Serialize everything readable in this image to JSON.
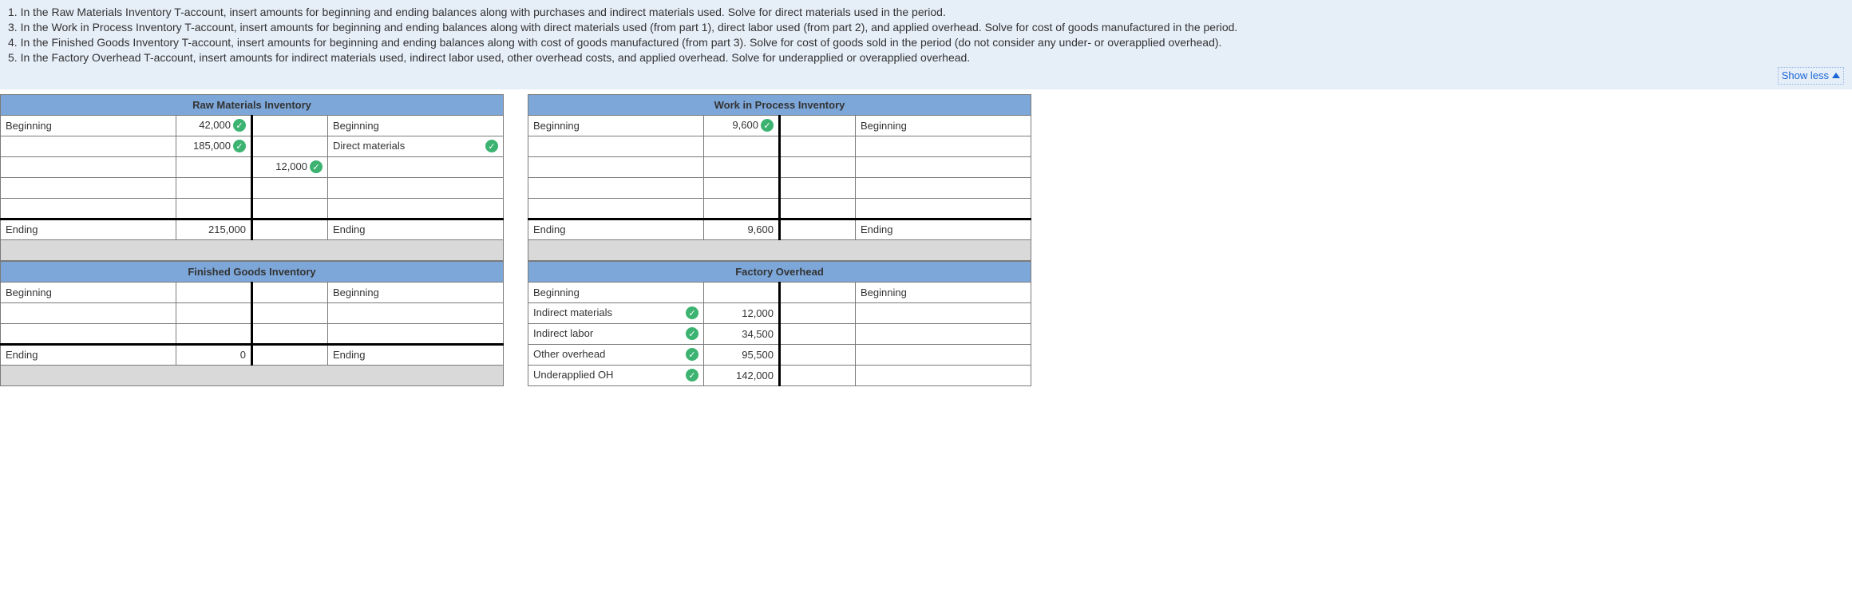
{
  "instructions": {
    "line1": "1. In the Raw Materials Inventory T-account, insert amounts for beginning and ending balances along with purchases and indirect materials used. Solve for direct materials used in the period.",
    "line3": "3. In the Work in Process Inventory T-account, insert amounts for beginning and ending balances along with direct materials used (from part 1), direct labor used (from part 2), and applied overhead. Solve for cost of goods manufactured in the period.",
    "line4": "4. In the Finished Goods Inventory T-account, insert amounts for beginning and ending balances along with cost of goods manufactured (from part 3). Solve for cost of goods sold in the period (do not consider any under- or overapplied overhead).",
    "line5": "5. In the Factory Overhead T-account, insert amounts for indirect materials used, indirect labor used, other overhead costs, and applied overhead. Solve for underapplied or overapplied overhead."
  },
  "show_less": "Show less",
  "labels": {
    "beginning": "Beginning",
    "ending": "Ending",
    "direct_materials": "Direct materials",
    "indirect_materials": "Indirect materials",
    "indirect_labor": "Indirect labor",
    "other_overhead": "Other overhead",
    "underapplied_oh": "Underapplied OH"
  },
  "accounts": {
    "raw": {
      "title": "Raw Materials Inventory",
      "rows": [
        {
          "l_label": "Beginning",
          "l_val": "42,000",
          "l_check": true,
          "r_val": "",
          "r_label": "Beginning"
        },
        {
          "l_label": "",
          "l_val": "185,000",
          "l_check": true,
          "r_val": "",
          "r_label": "Direct materials",
          "r_check": true
        },
        {
          "l_label": "",
          "l_val": "",
          "r_val": "12,000",
          "r_check": true,
          "r_label": ""
        },
        {
          "l_label": "",
          "l_val": "",
          "r_val": "",
          "r_label": ""
        },
        {
          "l_label": "",
          "l_val": "",
          "r_val": "",
          "r_label": ""
        }
      ],
      "ending": {
        "l_label": "Ending",
        "l_val": "215,000",
        "r_label": "Ending"
      }
    },
    "wip": {
      "title": "Work in Process Inventory",
      "rows": [
        {
          "l_label": "Beginning",
          "l_val": "9,600",
          "l_check": true,
          "r_val": "",
          "r_label": "Beginning"
        },
        {
          "l_label": "",
          "l_val": "",
          "r_val": "",
          "r_label": ""
        },
        {
          "l_label": "",
          "l_val": "",
          "r_val": "",
          "r_label": ""
        },
        {
          "l_label": "",
          "l_val": "",
          "r_val": "",
          "r_label": ""
        },
        {
          "l_label": "",
          "l_val": "",
          "r_val": "",
          "r_label": ""
        }
      ],
      "ending": {
        "l_label": "Ending",
        "l_val": "9,600",
        "r_label": "Ending"
      }
    },
    "fg": {
      "title": "Finished Goods Inventory",
      "rows": [
        {
          "l_label": "Beginning",
          "l_val": "",
          "r_val": "",
          "r_label": "Beginning"
        },
        {
          "l_label": "",
          "l_val": "",
          "r_val": "",
          "r_label": ""
        },
        {
          "l_label": "",
          "l_val": "",
          "r_val": "",
          "r_label": ""
        }
      ],
      "ending": {
        "l_label": "Ending",
        "l_val": "0",
        "r_label": "Ending"
      }
    },
    "foh": {
      "title": "Factory Overhead",
      "rows": [
        {
          "l_label": "Beginning",
          "l_val": "",
          "r_val": "",
          "r_label": "Beginning"
        },
        {
          "l_label": "Indirect materials",
          "l_check": true,
          "l_val": "12,000",
          "r_val": "",
          "r_label": ""
        },
        {
          "l_label": "Indirect labor",
          "l_check": true,
          "l_val": "34,500",
          "r_val": "",
          "r_label": ""
        },
        {
          "l_label": "Other overhead",
          "l_check": true,
          "l_val": "95,500",
          "r_val": "",
          "r_label": ""
        },
        {
          "l_label": "Underapplied OH",
          "l_check": true,
          "l_val": "142,000",
          "r_val": "",
          "r_label": ""
        }
      ]
    }
  }
}
